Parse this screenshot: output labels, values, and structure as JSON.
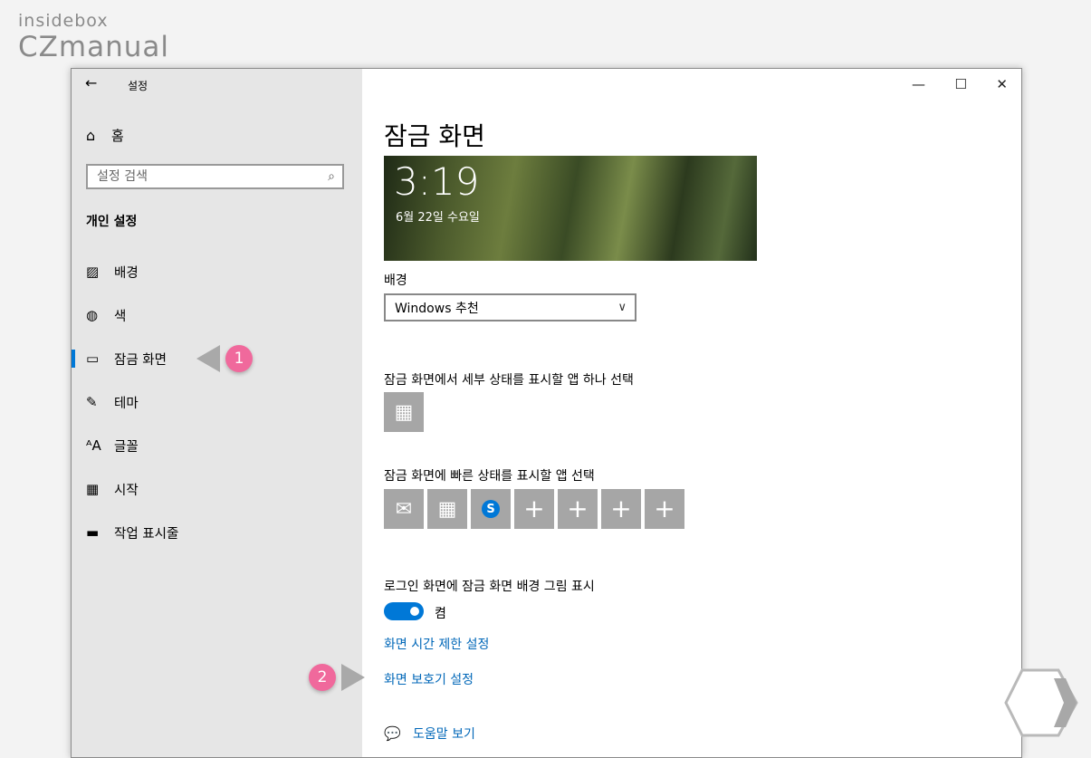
{
  "watermark": {
    "line1": "insidebox",
    "line2": "CZmanual"
  },
  "window": {
    "back_glyph": "←",
    "title": "설정",
    "controls": {
      "minimize": "—",
      "maximize": "☐",
      "close": "✕"
    }
  },
  "sidebar": {
    "home_label": "홈",
    "search_placeholder": "설정 검색",
    "section_title": "개인 설정",
    "items": [
      {
        "label": "배경",
        "icon": "picture-icon"
      },
      {
        "label": "색",
        "icon": "palette-icon"
      },
      {
        "label": "잠금 화면",
        "icon": "lock-screen-icon",
        "active": true
      },
      {
        "label": "테마",
        "icon": "theme-icon"
      },
      {
        "label": "글꼴",
        "icon": "font-icon"
      },
      {
        "label": "시작",
        "icon": "start-icon"
      },
      {
        "label": "작업 표시줄",
        "icon": "taskbar-icon"
      }
    ]
  },
  "annotations": [
    {
      "number": "1",
      "target": "sidebar-item-lock-screen"
    },
    {
      "number": "2",
      "target": "screen-saver-settings-link"
    }
  ],
  "content": {
    "page_title": "잠금 화면",
    "preview": {
      "time": "3:19",
      "date": "6월 22일 수요일"
    },
    "background_label": "배경",
    "background_value": "Windows 추천",
    "detailed_status_label": "잠금 화면에서 세부 상태를 표시할 앱 하나 선택",
    "quick_status_label": "잠금 화면에 빠른 상태를 표시할 앱 선택",
    "quick_tiles": [
      "mail-icon",
      "calendar-icon",
      "skype-icon",
      "plus-icon",
      "plus-icon",
      "plus-icon",
      "plus-icon"
    ],
    "login_bg_label": "로그인 화면에 잠금 화면 배경 그림 표시",
    "toggle_state": "켬",
    "link_timeout": "화면 시간 제한 설정",
    "link_screensaver": "화면 보호기 설정",
    "help_label": "도움말 보기",
    "skype_letter": "S"
  },
  "colors": {
    "accent": "#0078d7",
    "link": "#0067b8",
    "badge": "#f0699c",
    "sidebar_bg": "#e6e6e6",
    "tile_bg": "#a6a6a6"
  }
}
